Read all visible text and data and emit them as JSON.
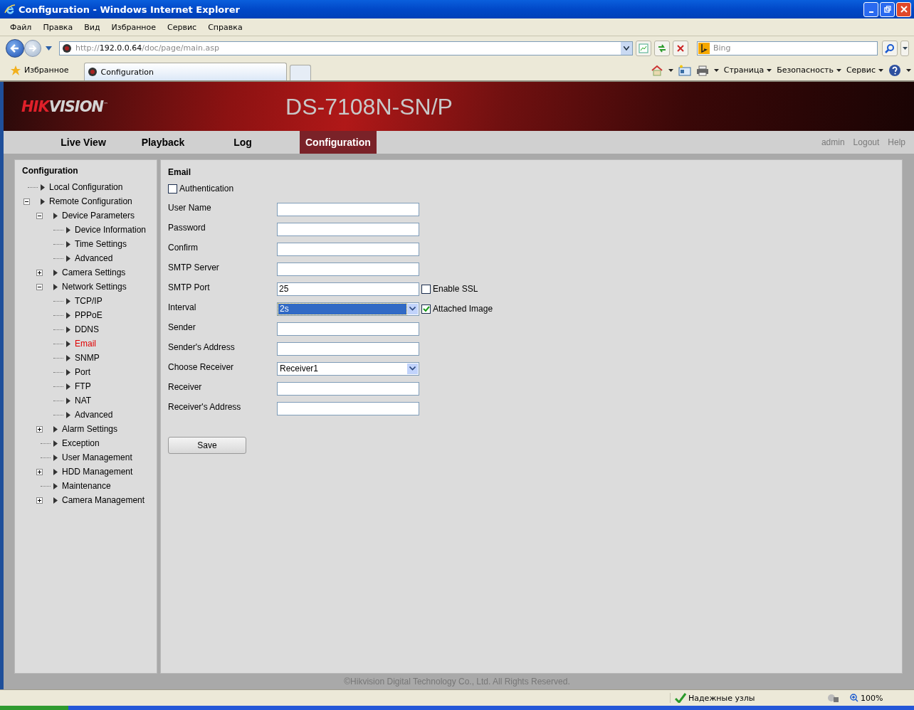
{
  "window": {
    "title": "Configuration - Windows Internet Explorer"
  },
  "menu": [
    "Файл",
    "Правка",
    "Вид",
    "Избранное",
    "Сервис",
    "Справка"
  ],
  "address": {
    "scheme": "http://",
    "host": "192.0.0.64",
    "path": "/doc/page/main.asp"
  },
  "search": {
    "placeholder": "Bing"
  },
  "favorites": {
    "label": "Избранное"
  },
  "browser_tabs": [
    {
      "label": "Configuration",
      "selected": true
    }
  ],
  "commands": [
    "Страница",
    "Безопасность",
    "Сервис"
  ],
  "banner": {
    "logo": [
      "HIK",
      "VISION"
    ],
    "trademark": "™",
    "model": "DS-7108N-SN/P"
  },
  "nav": [
    {
      "label": "Live View",
      "selected": false
    },
    {
      "label": "Playback",
      "selected": false
    },
    {
      "label": "Log",
      "selected": false
    },
    {
      "label": "Configuration",
      "selected": true
    }
  ],
  "user_links": [
    "admin",
    "Logout",
    "Help"
  ],
  "sidebar": {
    "title": "Configuration",
    "items": [
      {
        "label": "Local Configuration",
        "selected": false
      },
      {
        "label": "Remote Configuration",
        "selected": false,
        "expanded": true,
        "children": [
          {
            "label": "Device Parameters",
            "selected": false,
            "expanded": true,
            "children": [
              {
                "label": "Device Information",
                "selected": false
              },
              {
                "label": "Time Settings",
                "selected": false
              },
              {
                "label": "Advanced",
                "selected": false
              }
            ]
          },
          {
            "label": "Camera Settings",
            "selected": false,
            "expanded": false
          },
          {
            "label": "Network Settings",
            "selected": false,
            "expanded": true,
            "children": [
              {
                "label": "TCP/IP",
                "selected": false
              },
              {
                "label": "PPPoE",
                "selected": false
              },
              {
                "label": "DDNS",
                "selected": false
              },
              {
                "label": "Email",
                "selected": true
              },
              {
                "label": "SNMP",
                "selected": false
              },
              {
                "label": "Port",
                "selected": false
              },
              {
                "label": "FTP",
                "selected": false
              },
              {
                "label": "NAT",
                "selected": false
              },
              {
                "label": "Advanced",
                "selected": false
              }
            ]
          },
          {
            "label": "Alarm Settings",
            "selected": false,
            "expanded": false
          },
          {
            "label": "Exception",
            "selected": false
          },
          {
            "label": "User Management",
            "selected": false
          },
          {
            "label": "HDD Management",
            "selected": false,
            "expanded": false
          },
          {
            "label": "Maintenance",
            "selected": false
          },
          {
            "label": "Camera Management",
            "selected": false,
            "expanded": false
          }
        ]
      }
    ]
  },
  "form": {
    "title": "Email",
    "authentication": {
      "label": "Authentication",
      "checked": false
    },
    "rows": [
      {
        "kind": "text",
        "label": "User Name"
      },
      {
        "kind": "text",
        "label": "Password"
      },
      {
        "kind": "text",
        "label": "Confirm"
      },
      {
        "kind": "text",
        "label": "SMTP Server"
      },
      {
        "kind": "text",
        "label": "SMTP Port",
        "value": "25",
        "option": {
          "label": "Enable SSL",
          "checked": false
        }
      },
      {
        "kind": "select",
        "label": "Interval",
        "value": "2s",
        "highlighted": true,
        "option": {
          "label": "Attached Image",
          "checked": true
        }
      },
      {
        "kind": "text",
        "label": "Sender"
      },
      {
        "kind": "text",
        "label": "Sender's Address"
      },
      {
        "kind": "select",
        "label": "Choose Receiver",
        "value": "Receiver1",
        "highlighted": false
      },
      {
        "kind": "text",
        "label": "Receiver"
      },
      {
        "kind": "text",
        "label": "Receiver's Address"
      }
    ],
    "save": "Save"
  },
  "footer": "©Hikvision Digital Technology Co., Ltd. All Rights Reserved.",
  "status_bar": {
    "zone": "Надежные узлы",
    "zoom": "100%"
  }
}
